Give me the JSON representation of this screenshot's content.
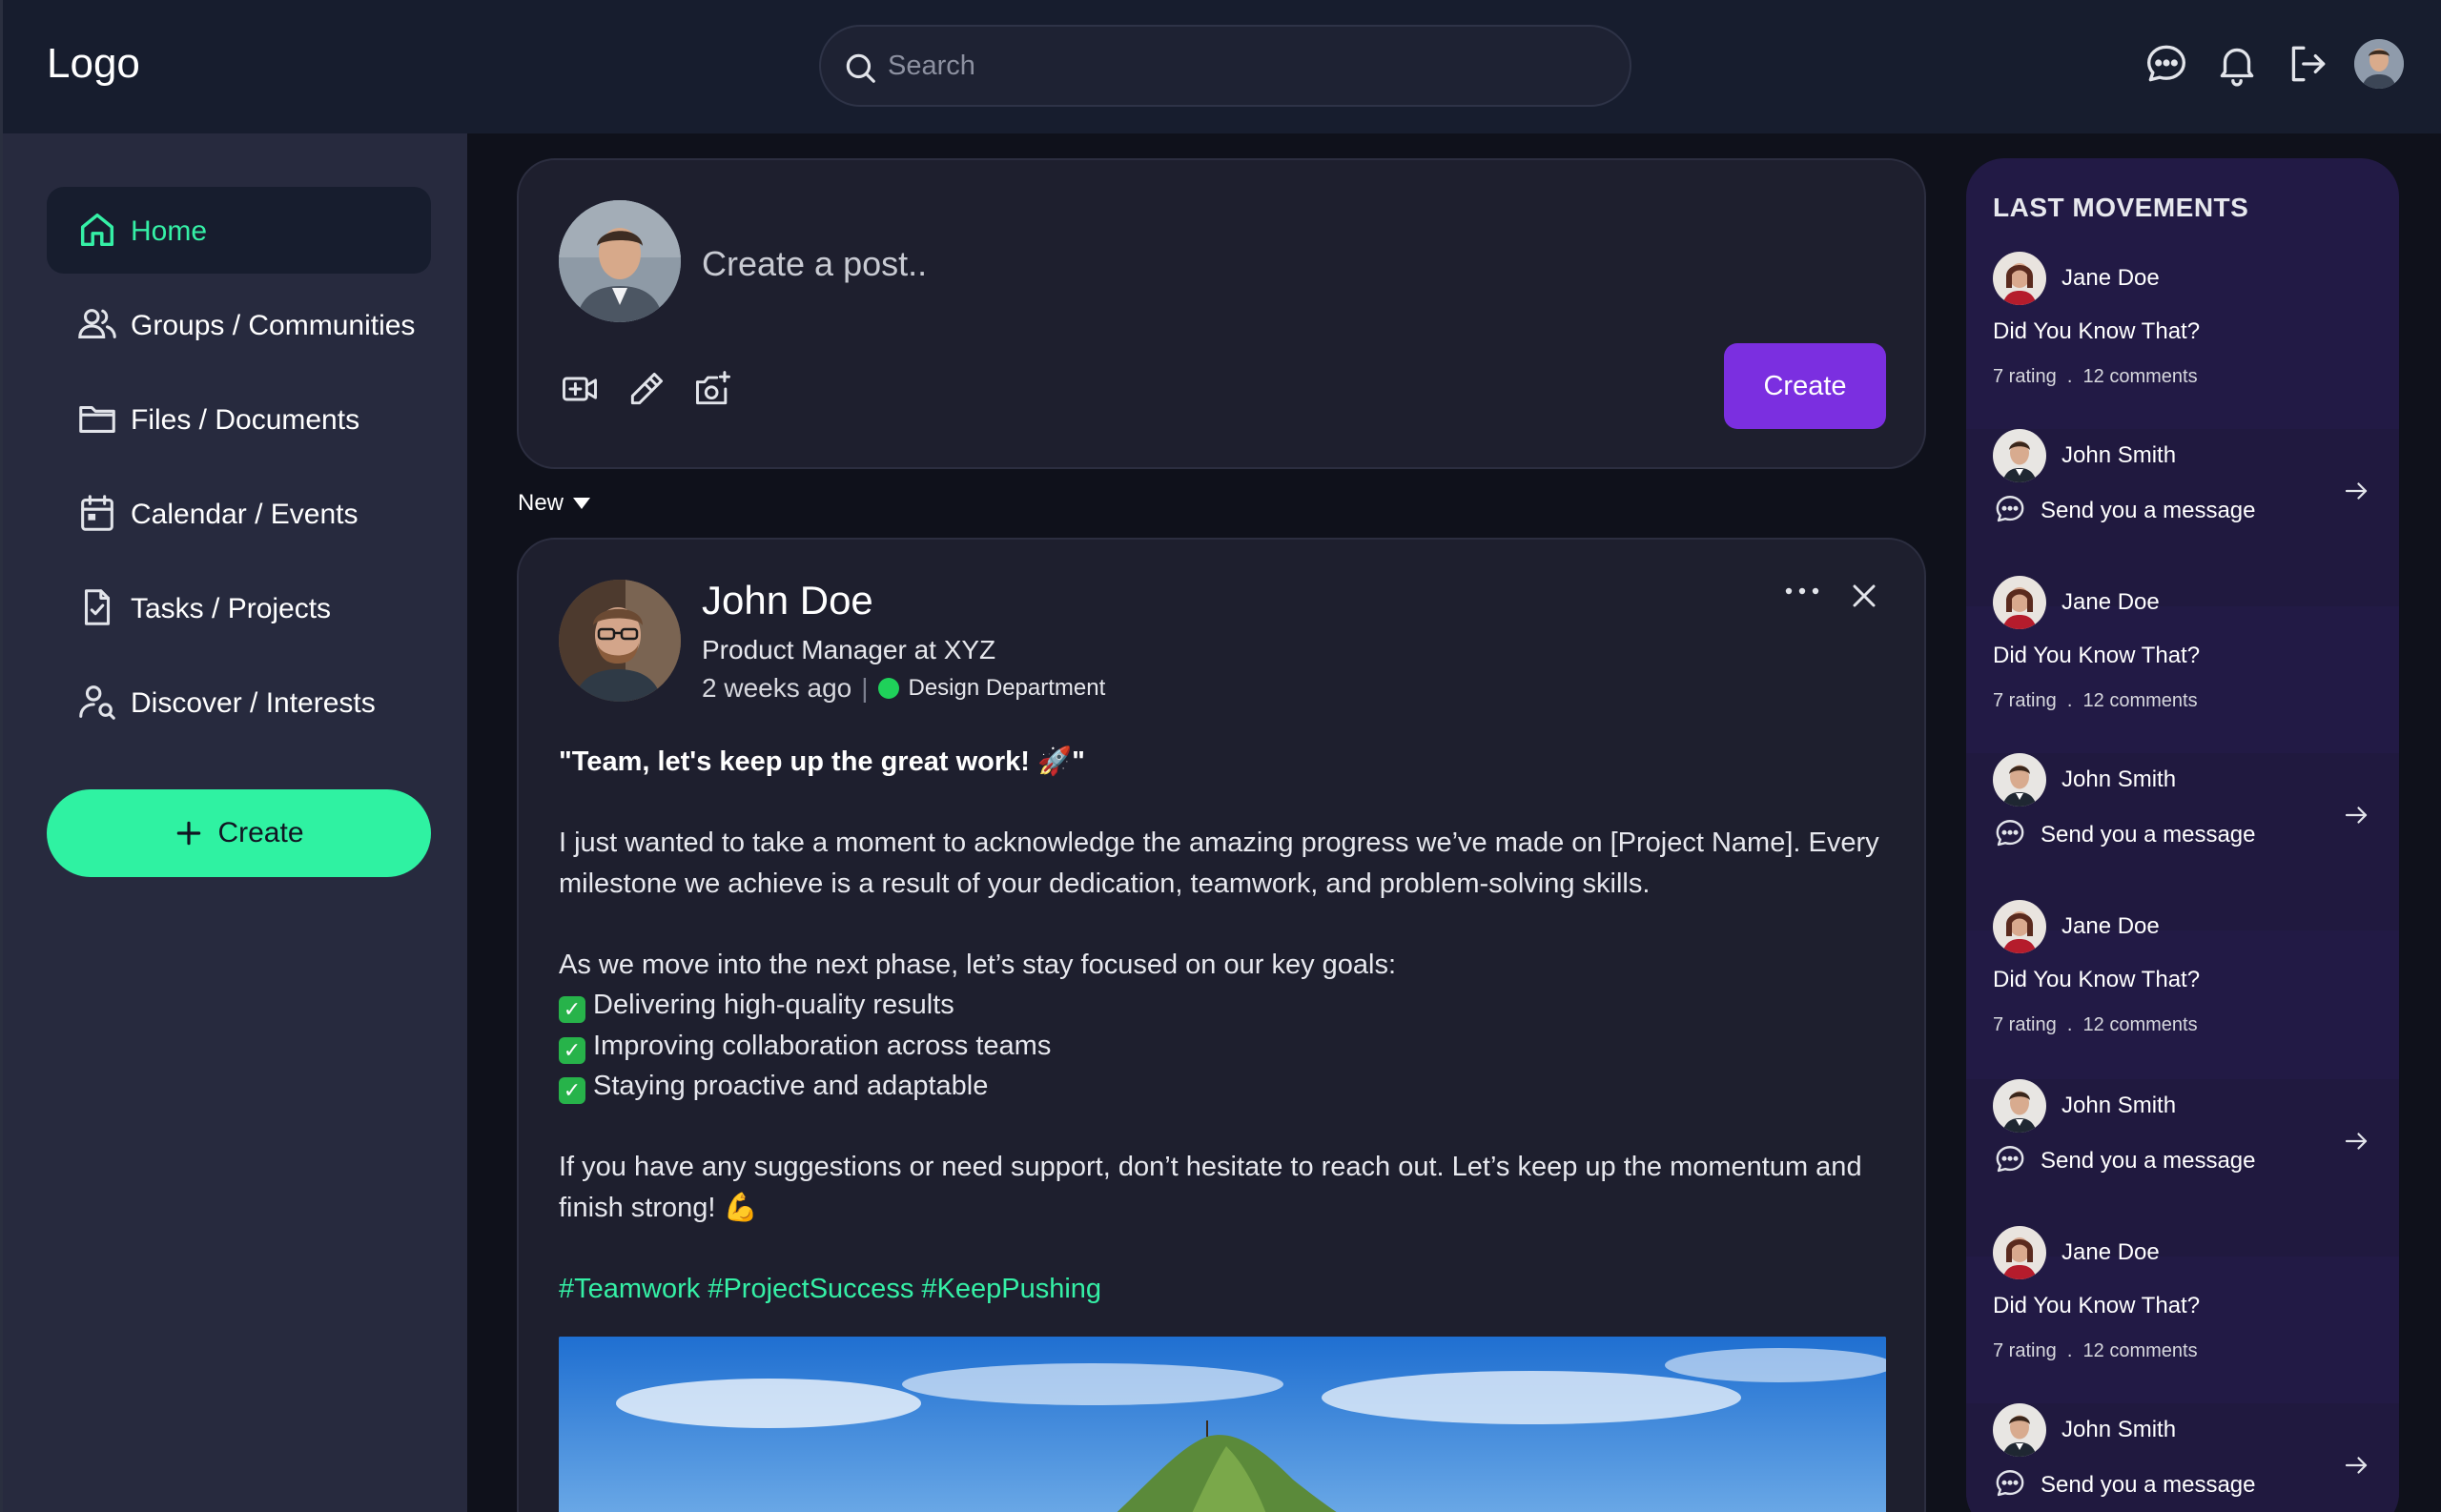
{
  "brand": {
    "logo": "Logo"
  },
  "search": {
    "placeholder": "Search"
  },
  "sidebar": {
    "items": [
      {
        "label": "Home",
        "icon": "home-icon",
        "active": true
      },
      {
        "label": "Groups / Communities",
        "icon": "users-icon"
      },
      {
        "label": "Files / Documents",
        "icon": "folder-icon"
      },
      {
        "label": "Calendar / Events",
        "icon": "calendar-icon"
      },
      {
        "label": "Tasks / Projects",
        "icon": "task-file-icon"
      },
      {
        "label": "Discover / Interests",
        "icon": "user-search-icon"
      }
    ],
    "create_label": "Create"
  },
  "composer": {
    "placeholder": "Create a post..",
    "tools": [
      "video-add-icon",
      "pen-icon",
      "camera-add-icon"
    ],
    "create_label": "Create"
  },
  "feed": {
    "sort_label": "New"
  },
  "post": {
    "author": "John Doe",
    "role": "Product Manager at XYZ",
    "time": "2 weeks ago",
    "separator": "|",
    "department": "Design Department",
    "headline": "\"Team, let's keep up the great work! 🚀\"",
    "paragraph1": "I just wanted to take a moment to acknowledge the amazing progress we’ve made on [Project Name]. Every milestone we achieve is a result of your dedication, teamwork, and problem-solving skills.",
    "goals_intro": "As we move into the next phase, let’s stay focused on our key goals:",
    "goals": [
      "Delivering high-quality results",
      "Improving collaboration across teams",
      "Staying proactive and adaptable"
    ],
    "closing": "If you have any suggestions or need support, don’t hesitate to reach out. Let’s keep up the momentum and finish strong! 💪",
    "tags": "#Teamwork #ProjectSuccess #KeepPushing"
  },
  "movements": {
    "title": "LAST MOVEMENTS",
    "items": [
      {
        "type": "post",
        "name": "Jane Doe",
        "text": "Did You Know That?",
        "rating": "7 rating",
        "dot": ".",
        "comments": "12 comments"
      },
      {
        "type": "message",
        "name": "John Smith",
        "text": "Send you a message"
      },
      {
        "type": "post",
        "name": "Jane Doe",
        "text": "Did You Know That?",
        "rating": "7 rating",
        "dot": ".",
        "comments": "12 comments"
      },
      {
        "type": "message",
        "name": "John Smith",
        "text": "Send you a message"
      },
      {
        "type": "post",
        "name": "Jane Doe",
        "text": "Did You Know That?",
        "rating": "7 rating",
        "dot": ".",
        "comments": "12 comments"
      },
      {
        "type": "message",
        "name": "John Smith",
        "text": "Send you a message"
      },
      {
        "type": "post",
        "name": "Jane Doe",
        "text": "Did You Know That?",
        "rating": "7 rating",
        "dot": ".",
        "comments": "12 comments"
      },
      {
        "type": "message",
        "name": "John Smith",
        "text": "Send you a message"
      }
    ]
  },
  "colors": {
    "accent": "#2ff2a2",
    "purple": "#7b2fe0",
    "panel": "#1e1f2e",
    "sidebar": "#272a3e",
    "topbar": "#171d2e"
  }
}
